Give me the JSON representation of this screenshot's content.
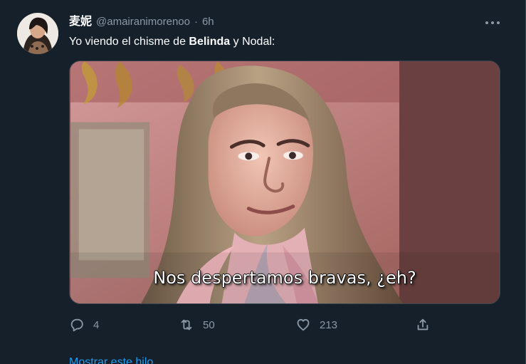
{
  "tweet": {
    "display_name": "麦妮",
    "handle": "@amairanimorenoo",
    "separator": "·",
    "time": "6h",
    "text_before": "Yo viendo el chisme de ",
    "text_bold": "Belinda",
    "text_after": " y Nodal:"
  },
  "media": {
    "subtitle": "Nos despertamos bravas, ¿eh?"
  },
  "actions": {
    "reply_count": "4",
    "retweet_count": "50",
    "like_count": "213"
  },
  "thread": {
    "label": "Mostrar este hilo"
  },
  "icons": {
    "more": "more-icon",
    "reply": "reply-icon",
    "retweet": "retweet-icon",
    "like": "heart-icon",
    "share": "share-icon"
  },
  "colors": {
    "background": "#15202b",
    "muted": "#8b98a5",
    "link": "#1d9bf0",
    "border": "#38444d"
  }
}
